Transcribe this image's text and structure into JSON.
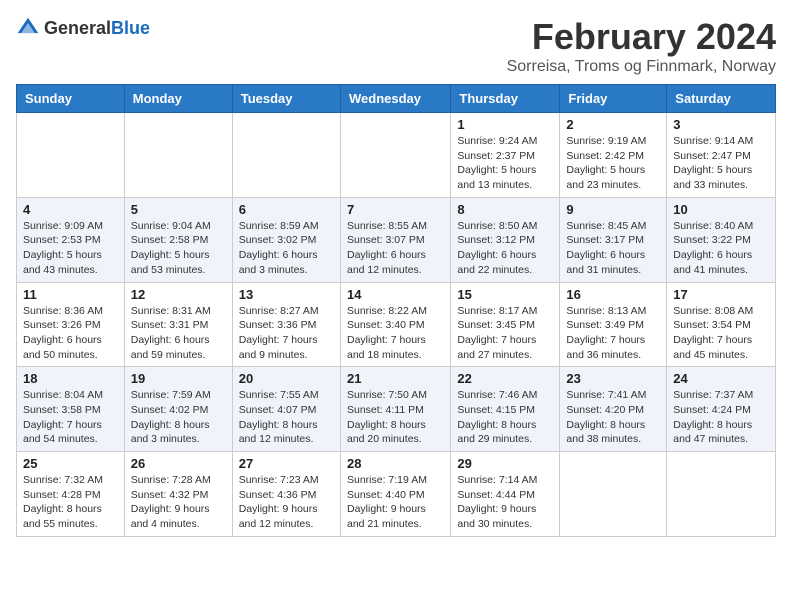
{
  "header": {
    "logo_general": "General",
    "logo_blue": "Blue",
    "month_title": "February 2024",
    "subtitle": "Sorreisa, Troms og Finnmark, Norway"
  },
  "weekdays": [
    "Sunday",
    "Monday",
    "Tuesday",
    "Wednesday",
    "Thursday",
    "Friday",
    "Saturday"
  ],
  "weeks": [
    [
      {
        "day": "",
        "info": ""
      },
      {
        "day": "",
        "info": ""
      },
      {
        "day": "",
        "info": ""
      },
      {
        "day": "",
        "info": ""
      },
      {
        "day": "1",
        "info": "Sunrise: 9:24 AM\nSunset: 2:37 PM\nDaylight: 5 hours\nand 13 minutes."
      },
      {
        "day": "2",
        "info": "Sunrise: 9:19 AM\nSunset: 2:42 PM\nDaylight: 5 hours\nand 23 minutes."
      },
      {
        "day": "3",
        "info": "Sunrise: 9:14 AM\nSunset: 2:47 PM\nDaylight: 5 hours\nand 33 minutes."
      }
    ],
    [
      {
        "day": "4",
        "info": "Sunrise: 9:09 AM\nSunset: 2:53 PM\nDaylight: 5 hours\nand 43 minutes."
      },
      {
        "day": "5",
        "info": "Sunrise: 9:04 AM\nSunset: 2:58 PM\nDaylight: 5 hours\nand 53 minutes."
      },
      {
        "day": "6",
        "info": "Sunrise: 8:59 AM\nSunset: 3:02 PM\nDaylight: 6 hours\nand 3 minutes."
      },
      {
        "day": "7",
        "info": "Sunrise: 8:55 AM\nSunset: 3:07 PM\nDaylight: 6 hours\nand 12 minutes."
      },
      {
        "day": "8",
        "info": "Sunrise: 8:50 AM\nSunset: 3:12 PM\nDaylight: 6 hours\nand 22 minutes."
      },
      {
        "day": "9",
        "info": "Sunrise: 8:45 AM\nSunset: 3:17 PM\nDaylight: 6 hours\nand 31 minutes."
      },
      {
        "day": "10",
        "info": "Sunrise: 8:40 AM\nSunset: 3:22 PM\nDaylight: 6 hours\nand 41 minutes."
      }
    ],
    [
      {
        "day": "11",
        "info": "Sunrise: 8:36 AM\nSunset: 3:26 PM\nDaylight: 6 hours\nand 50 minutes."
      },
      {
        "day": "12",
        "info": "Sunrise: 8:31 AM\nSunset: 3:31 PM\nDaylight: 6 hours\nand 59 minutes."
      },
      {
        "day": "13",
        "info": "Sunrise: 8:27 AM\nSunset: 3:36 PM\nDaylight: 7 hours\nand 9 minutes."
      },
      {
        "day": "14",
        "info": "Sunrise: 8:22 AM\nSunset: 3:40 PM\nDaylight: 7 hours\nand 18 minutes."
      },
      {
        "day": "15",
        "info": "Sunrise: 8:17 AM\nSunset: 3:45 PM\nDaylight: 7 hours\nand 27 minutes."
      },
      {
        "day": "16",
        "info": "Sunrise: 8:13 AM\nSunset: 3:49 PM\nDaylight: 7 hours\nand 36 minutes."
      },
      {
        "day": "17",
        "info": "Sunrise: 8:08 AM\nSunset: 3:54 PM\nDaylight: 7 hours\nand 45 minutes."
      }
    ],
    [
      {
        "day": "18",
        "info": "Sunrise: 8:04 AM\nSunset: 3:58 PM\nDaylight: 7 hours\nand 54 minutes."
      },
      {
        "day": "19",
        "info": "Sunrise: 7:59 AM\nSunset: 4:02 PM\nDaylight: 8 hours\nand 3 minutes."
      },
      {
        "day": "20",
        "info": "Sunrise: 7:55 AM\nSunset: 4:07 PM\nDaylight: 8 hours\nand 12 minutes."
      },
      {
        "day": "21",
        "info": "Sunrise: 7:50 AM\nSunset: 4:11 PM\nDaylight: 8 hours\nand 20 minutes."
      },
      {
        "day": "22",
        "info": "Sunrise: 7:46 AM\nSunset: 4:15 PM\nDaylight: 8 hours\nand 29 minutes."
      },
      {
        "day": "23",
        "info": "Sunrise: 7:41 AM\nSunset: 4:20 PM\nDaylight: 8 hours\nand 38 minutes."
      },
      {
        "day": "24",
        "info": "Sunrise: 7:37 AM\nSunset: 4:24 PM\nDaylight: 8 hours\nand 47 minutes."
      }
    ],
    [
      {
        "day": "25",
        "info": "Sunrise: 7:32 AM\nSunset: 4:28 PM\nDaylight: 8 hours\nand 55 minutes."
      },
      {
        "day": "26",
        "info": "Sunrise: 7:28 AM\nSunset: 4:32 PM\nDaylight: 9 hours\nand 4 minutes."
      },
      {
        "day": "27",
        "info": "Sunrise: 7:23 AM\nSunset: 4:36 PM\nDaylight: 9 hours\nand 12 minutes."
      },
      {
        "day": "28",
        "info": "Sunrise: 7:19 AM\nSunset: 4:40 PM\nDaylight: 9 hours\nand 21 minutes."
      },
      {
        "day": "29",
        "info": "Sunrise: 7:14 AM\nSunset: 4:44 PM\nDaylight: 9 hours\nand 30 minutes."
      },
      {
        "day": "",
        "info": ""
      },
      {
        "day": "",
        "info": ""
      }
    ]
  ]
}
